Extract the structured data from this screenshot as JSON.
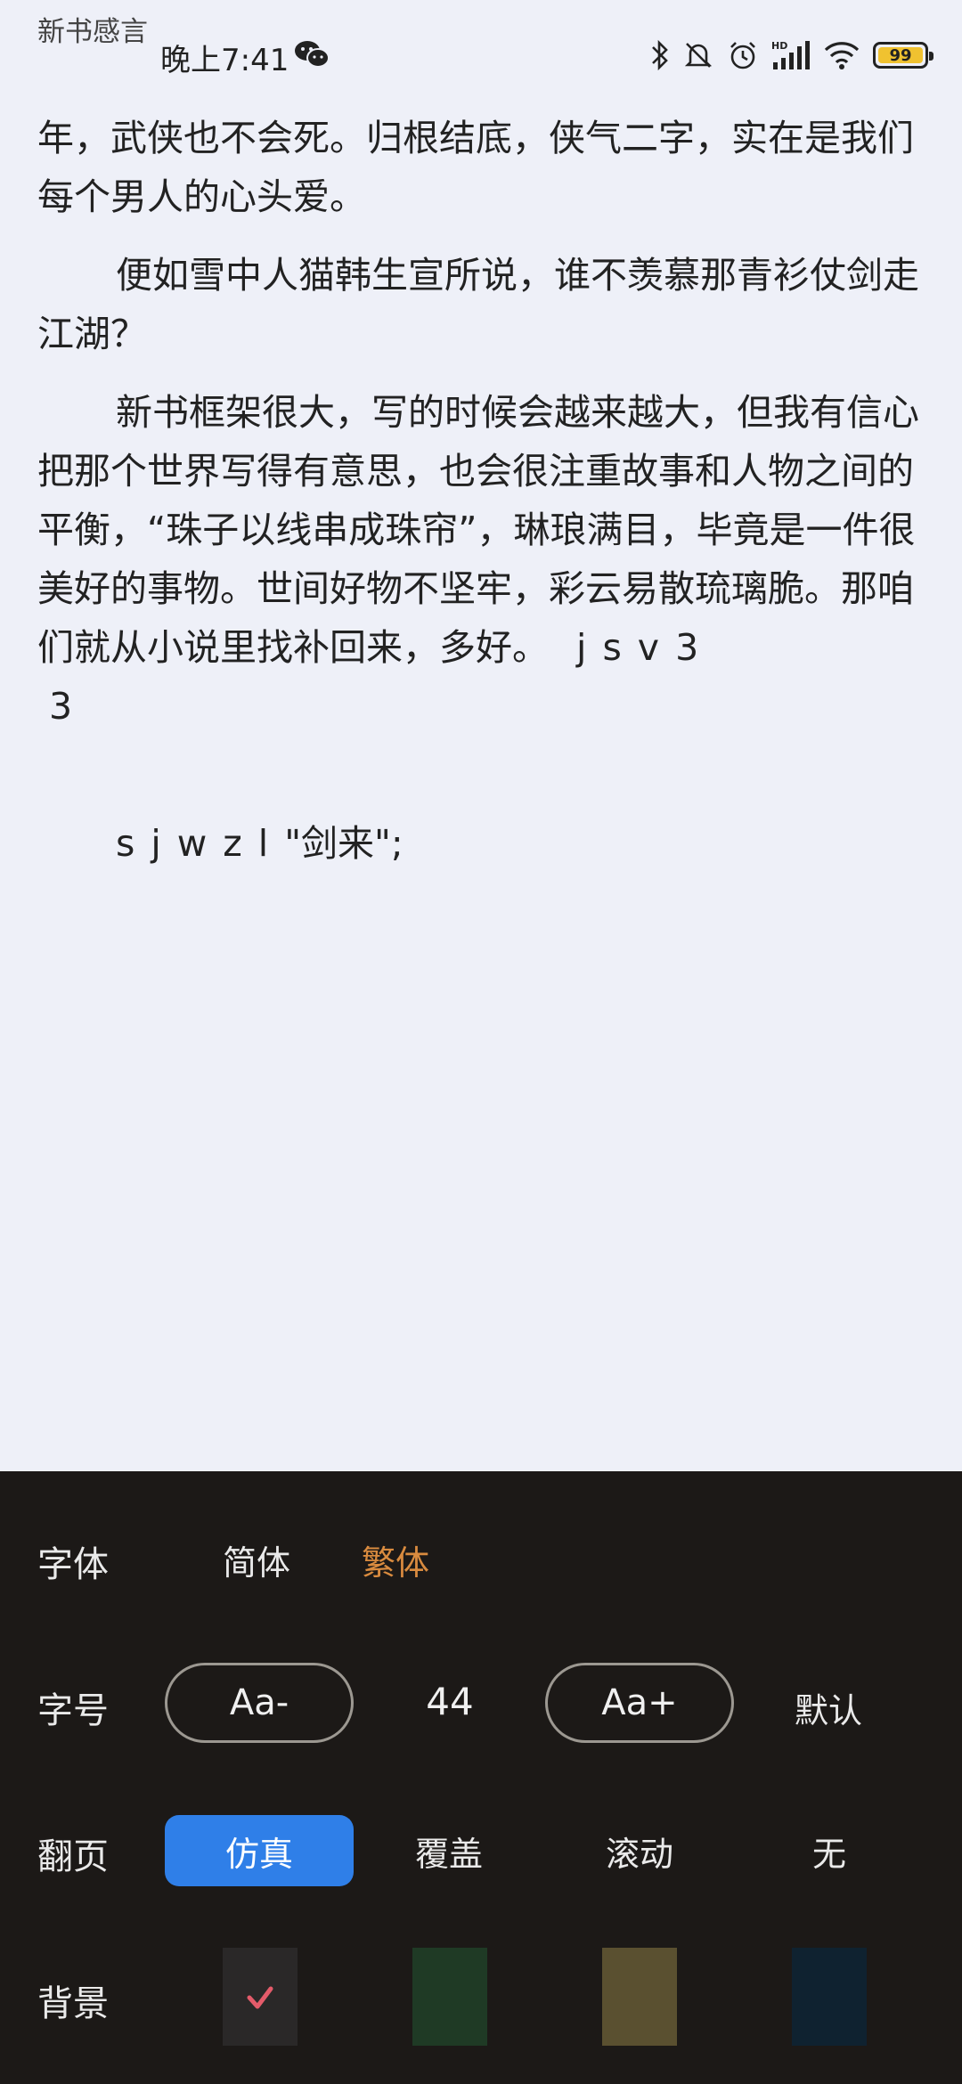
{
  "chapter_title": "新书感言",
  "status": {
    "time": "晚上7:41",
    "battery": "99",
    "icons": [
      "wechat-icon",
      "bluetooth-icon",
      "mute-icon",
      "alarm-icon",
      "hd-signal-icon",
      "wifi-icon",
      "battery-icon"
    ]
  },
  "content": {
    "paragraphs": [
      "年，武侠也不会死。归根结底，侠气二字，实在是我们每个男人的心头爱。",
      "便如雪中人猫韩生宣所说，谁不羡慕那青衫仗剑走江湖？",
      "新书框架很大，写的时候会越来越大，但我有信心把那个世界写得有意思，也会很注重故事和人物之间的平衡，“珠子以线串成珠帘”，琳琅满目，毕竟是一件很美好的事物。世间好物不坚牢，彩云易散琉璃脆。那咱们就从小说里找补回来，多好。"
    ],
    "trail_latin": "jsv3",
    "trail_end": "3",
    "last_line_latin": "sjwzl",
    "last_line_quote": "\"剑来\";"
  },
  "settings": {
    "font_label": "字体",
    "font_simplified": "简体",
    "font_traditional": "繁体",
    "size_label": "字号",
    "size_decrease": "Aa-",
    "size_value": "44",
    "size_increase": "Aa+",
    "size_default": "默认",
    "flip_label": "翻页",
    "flip_options": [
      "仿真",
      "覆盖",
      "滚动",
      "无"
    ],
    "bg_label": "背景",
    "bg_colors": [
      "#2a2828",
      "#1f3a25",
      "#5a5030",
      "#0f2230"
    ],
    "bg_selected_index": 0
  },
  "colors": {
    "accent": "#2f7fe8",
    "active_text": "#d98b3f",
    "panel_bg": "#1c1917",
    "page_bg": "#eef0f8"
  }
}
